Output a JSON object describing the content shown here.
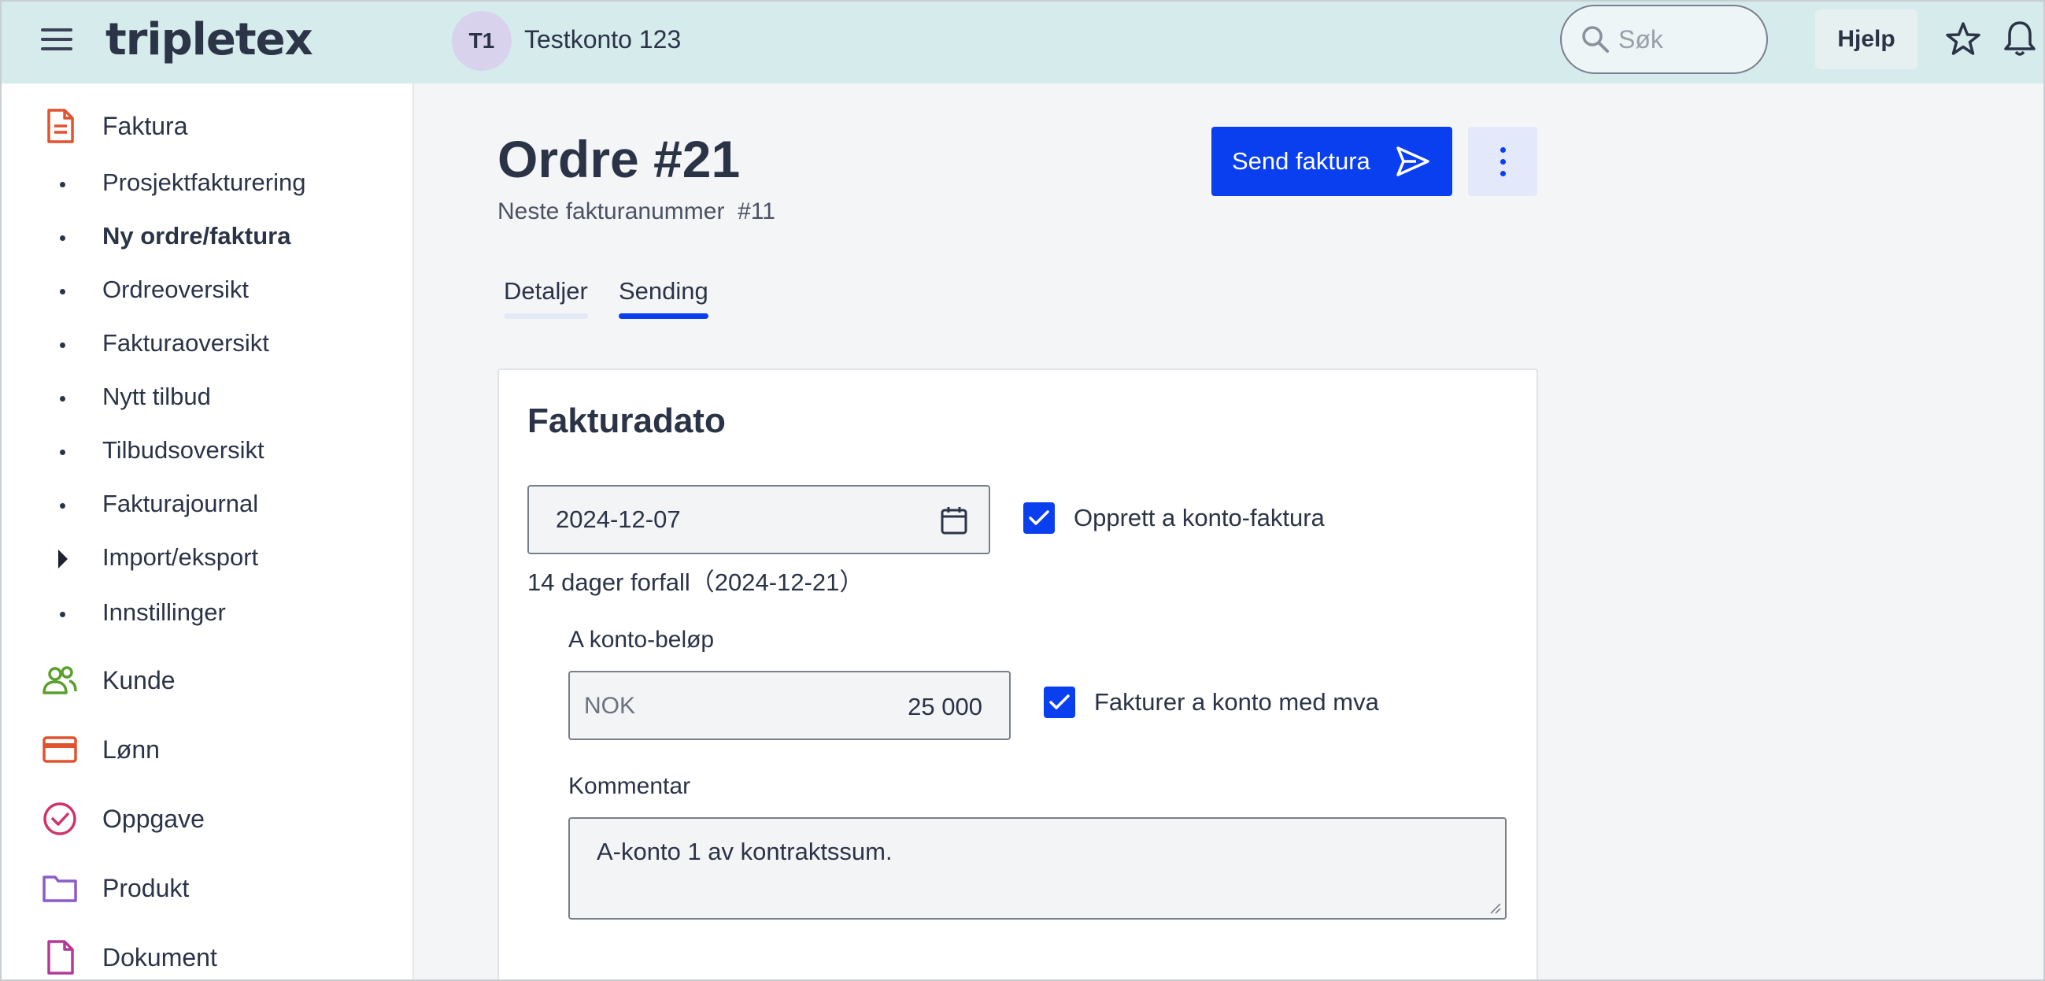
{
  "header": {
    "logo": "tripletex",
    "account_initials": "T1",
    "account_name": "Testkonto 123",
    "search_placeholder": "Søk",
    "help_label": "Hjelp"
  },
  "sidebar": {
    "section_main": "Faktura",
    "sub_items": [
      {
        "label": "Prosjektfakturering",
        "active": false
      },
      {
        "label": "Ny ordre/faktura",
        "active": true
      },
      {
        "label": "Ordreoversikt",
        "active": false
      },
      {
        "label": "Fakturaoversikt",
        "active": false
      },
      {
        "label": "Nytt tilbud",
        "active": false
      },
      {
        "label": "Tilbudsoversikt",
        "active": false
      },
      {
        "label": "Fakturajournal",
        "active": false
      },
      {
        "label": "Import/eksport",
        "active": false,
        "expandable": true
      },
      {
        "label": "Innstillinger",
        "active": false
      }
    ],
    "modules": [
      {
        "label": "Kunde",
        "icon": "people-icon",
        "color": "#5aa02c"
      },
      {
        "label": "Lønn",
        "icon": "card-icon",
        "color": "#e0532f"
      },
      {
        "label": "Oppgave",
        "icon": "check-circle-icon",
        "color": "#d0336c"
      },
      {
        "label": "Produkt",
        "icon": "folder-icon",
        "color": "#8a5cc9"
      },
      {
        "label": "Dokument",
        "icon": "document-icon",
        "color": "#b43a9a"
      }
    ],
    "faktura_icon_color": "#e0532f"
  },
  "main": {
    "title": "Ordre #21",
    "subtitle": "Neste fakturanummer  #11",
    "send_label": "Send faktura",
    "tabs": [
      {
        "label": "Detaljer",
        "active": false
      },
      {
        "label": "Sending",
        "active": true
      }
    ],
    "card": {
      "title": "Fakturadato",
      "date_value": "2024-12-07",
      "on_account_checkbox_label": "Opprett a konto-faktura",
      "on_account_checked": true,
      "due_text": "14 dager forfall（2024-12-21）",
      "amount_label": "A konto-beløp",
      "amount_currency": "NOK",
      "amount_value": "25 000",
      "vat_checkbox_label": "Fakturer a konto med mva",
      "vat_checked": true,
      "comment_label": "Kommentar",
      "comment_value": "A-konto 1 av kontraktssum."
    }
  },
  "colors": {
    "header_bg": "#d5ebec",
    "primary": "#0a3ff0"
  }
}
